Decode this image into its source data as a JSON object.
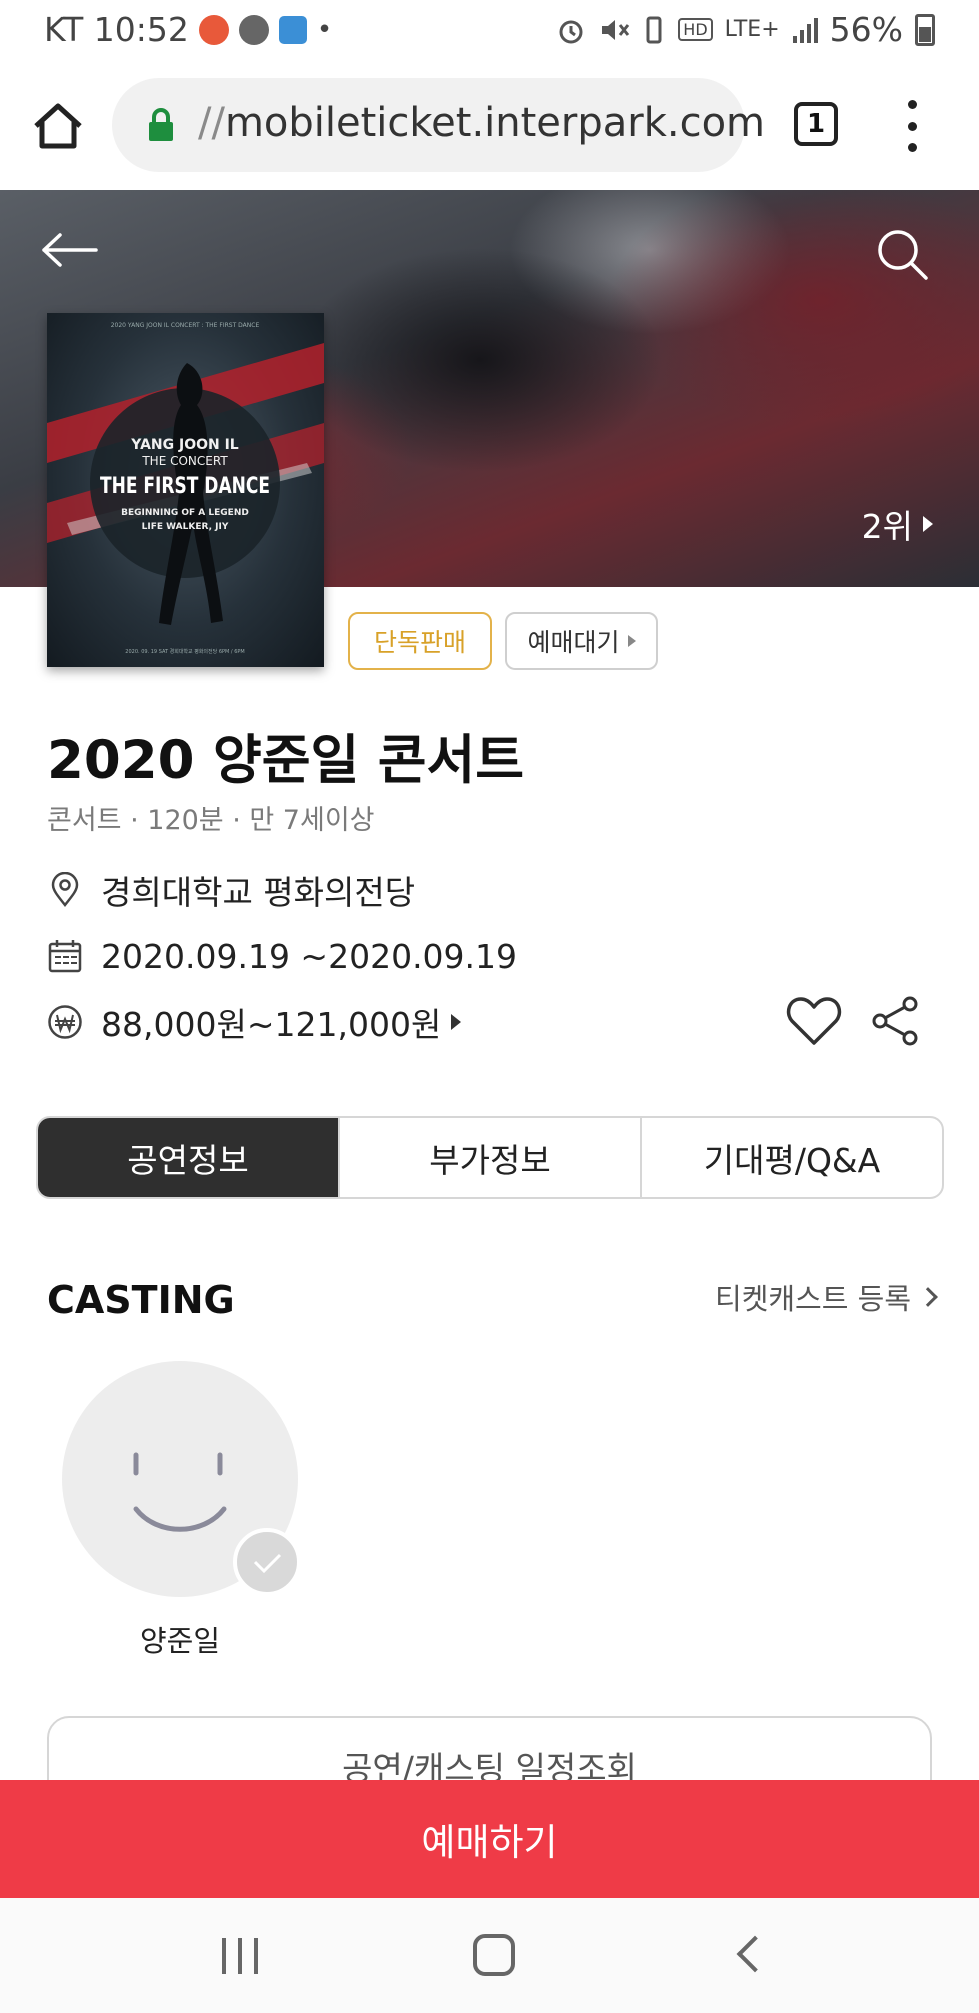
{
  "status_bar": {
    "carrier_time": "KT 10:52",
    "dot": "•",
    "network": "LTE+",
    "hd": "HD",
    "battery": "56%"
  },
  "browser": {
    "url_prefix": "//",
    "url_host": "mobileticket.interpark.com",
    "tab_count": "1"
  },
  "hero": {
    "rank": "2위"
  },
  "poster": {
    "top_line": "2020 YANG JOON IL CONCERT : THE FIRST DANCE",
    "artist": "YANG JOON IL",
    "the_concert": "THE CONCERT",
    "main_title": "THE FIRST DANCE",
    "subtitle1": "BEGINNING OF A LEGEND",
    "subtitle2": "LIFE WALKER, JIY",
    "bottom_line": "2020. 09. 19 SAT 경희대학교 평화의전당 6PM / 6PM"
  },
  "badges": {
    "exclusive": "단독판매",
    "waiting": "예매대기"
  },
  "show": {
    "title": "2020 양준일 콘서트",
    "meta": "콘서트 · 120분 · 만 7세이상",
    "venue": "경희대학교 평화의전당",
    "dates": "2020.09.19  ~2020.09.19",
    "price": "88,000원~121,000원"
  },
  "tabs": [
    {
      "label": "공연정보",
      "active": true
    },
    {
      "label": "부가정보",
      "active": false
    },
    {
      "label": "기대평/Q&A",
      "active": false
    }
  ],
  "casting": {
    "title": "CASTING",
    "register_link": "티켓캐스트 등록",
    "members": [
      {
        "name": "양준일"
      }
    ],
    "schedule_button": "공연/캐스팅 일정조회"
  },
  "book_button": "예매하기",
  "colors": {
    "accent_red": "#ef3b47",
    "badge_gold": "#d8a128",
    "lock_green": "#1e8e3e",
    "tab_active": "#2f2f2f"
  },
  "icons": [
    "home-icon",
    "lock-icon",
    "menu-dots-icon",
    "back-arrow-icon",
    "search-icon",
    "location-pin-icon",
    "calendar-icon",
    "won-icon",
    "heart-icon",
    "share-icon",
    "chevron-right-icon",
    "check-icon"
  ]
}
